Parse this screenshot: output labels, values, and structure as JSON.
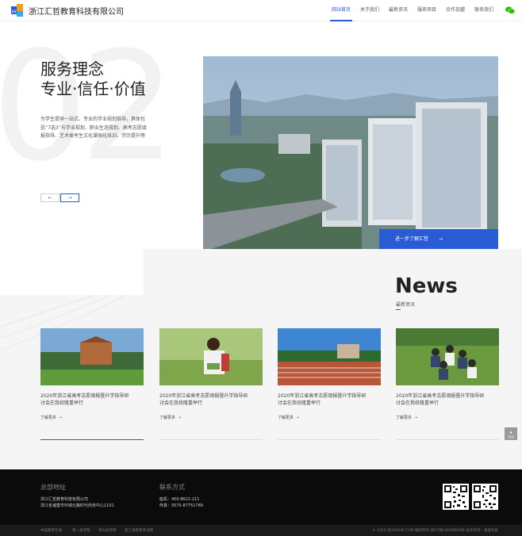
{
  "header": {
    "brand": "浙江汇哲教育科技有限公司",
    "nav": [
      "网站首页",
      "关于我们",
      "最新资讯",
      "服务项目",
      "合作加盟",
      "联系我们"
    ],
    "active_index": 0
  },
  "hero": {
    "big_digit": "02",
    "title_line1": "服务理念",
    "title_line2": "专业·信任·价值",
    "description": "为学生提供一站式、专业的学业规划指导，具体包括“7选3”与学业规划、职业生涯规划、高考志愿填报指导、艺术类考生文化课强化培训、学历提升等",
    "prev_label": "←",
    "next_label": "→",
    "cta_label": "进一步了解汇哲",
    "cta_arrow": "→"
  },
  "news": {
    "title": "News",
    "subtitle": "最新资讯",
    "items": [
      {
        "title": "2020年浙江省高考志愿填报暨升学指导研讨会在我校隆重举行",
        "more": "了解更多",
        "arrow": "→"
      },
      {
        "title": "2020年浙江省高考志愿填报暨升学指导研讨会在我校隆重举行",
        "more": "了解更多",
        "arrow": "→"
      },
      {
        "title": "2020年浙江省高考志愿填报暨升学指导研讨会在我校隆重举行",
        "more": "了解更多",
        "arrow": "→"
      },
      {
        "title": "2020年浙江省高考志愿填报暨升学指导研讨会在我校隆重举行",
        "more": "了解更多",
        "arrow": "→"
      }
    ]
  },
  "top_button": "TOP",
  "footer": {
    "address_heading": "总部地址",
    "address_line1": "浙江汇哲教育科技有限公司",
    "address_line2": "浙江省诸暨市环城北路时代商务中心1101",
    "contact_heading": "联系方式",
    "phone": "座机：400-8621-211",
    "fax": "传真：0575-87751789",
    "bottom_links": [
      "中国教育在线",
      "第一高考网",
      "阳光高考网",
      "浙江省教育考试网"
    ],
    "copyright": "© 2020 ZJHUIZHE.COM 版权所有 浙ICP备18058809号 技术支持：奥金科技"
  },
  "colors": {
    "accent": "#2a5bd7",
    "footer_bg": "#0b0b0b",
    "panel_bg": "#f5f5f5"
  }
}
